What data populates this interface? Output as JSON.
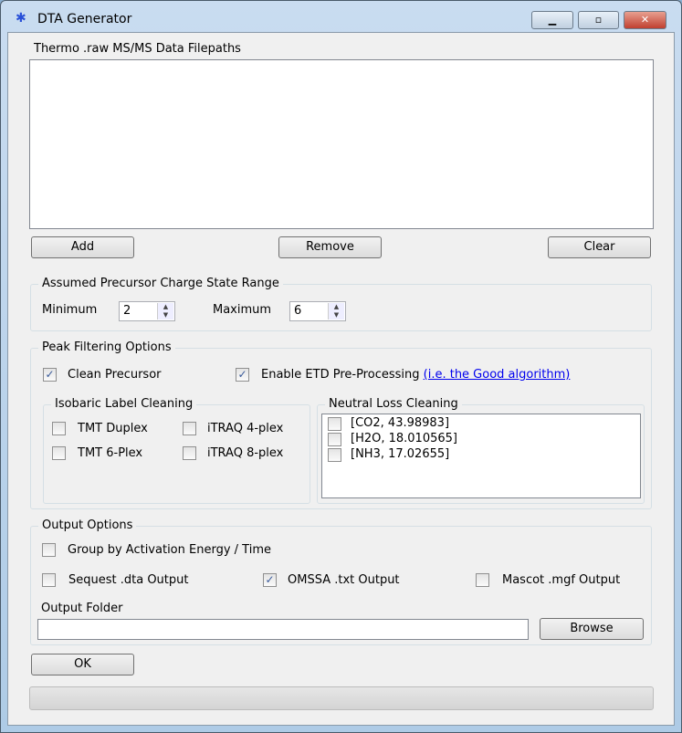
{
  "window": {
    "title": "DTA Generator",
    "minimize": "▁",
    "maximize": "▫",
    "close": "✕"
  },
  "files": {
    "label": "Thermo .raw MS/MS Data Filepaths",
    "add": "Add",
    "remove": "Remove",
    "clear": "Clear"
  },
  "charge": {
    "title": "Assumed Precursor Charge State Range",
    "min_label": "Minimum",
    "min_value": "2",
    "max_label": "Maximum",
    "max_value": "6"
  },
  "peak": {
    "title": "Peak Filtering Options",
    "clean_precursor": "Clean Precursor",
    "clean_precursor_checked": true,
    "etd": "Enable ETD Pre-Processing",
    "etd_checked": true,
    "etd_link": "(i.e. the Good algorithm)",
    "isobaric": {
      "title": "Isobaric Label Cleaning",
      "items": [
        "TMT Duplex",
        "iTRAQ 4-plex",
        "TMT 6-Plex",
        "iTRAQ 8-plex"
      ]
    },
    "neutral": {
      "title": "Neutral Loss Cleaning",
      "items": [
        "[CO2, 43.98983]",
        "[H2O, 18.010565]",
        "[NH3, 17.02655]"
      ]
    }
  },
  "output": {
    "title": "Output Options",
    "group_by": "Group by Activation Energy / Time",
    "sequest": "Sequest .dta Output",
    "omssa": "OMSSA .txt Output",
    "omssa_checked": true,
    "mascot": "Mascot .mgf Output",
    "folder_label": "Output Folder",
    "folder_value": "",
    "browse": "Browse"
  },
  "ok": "OK",
  "progress": 0
}
